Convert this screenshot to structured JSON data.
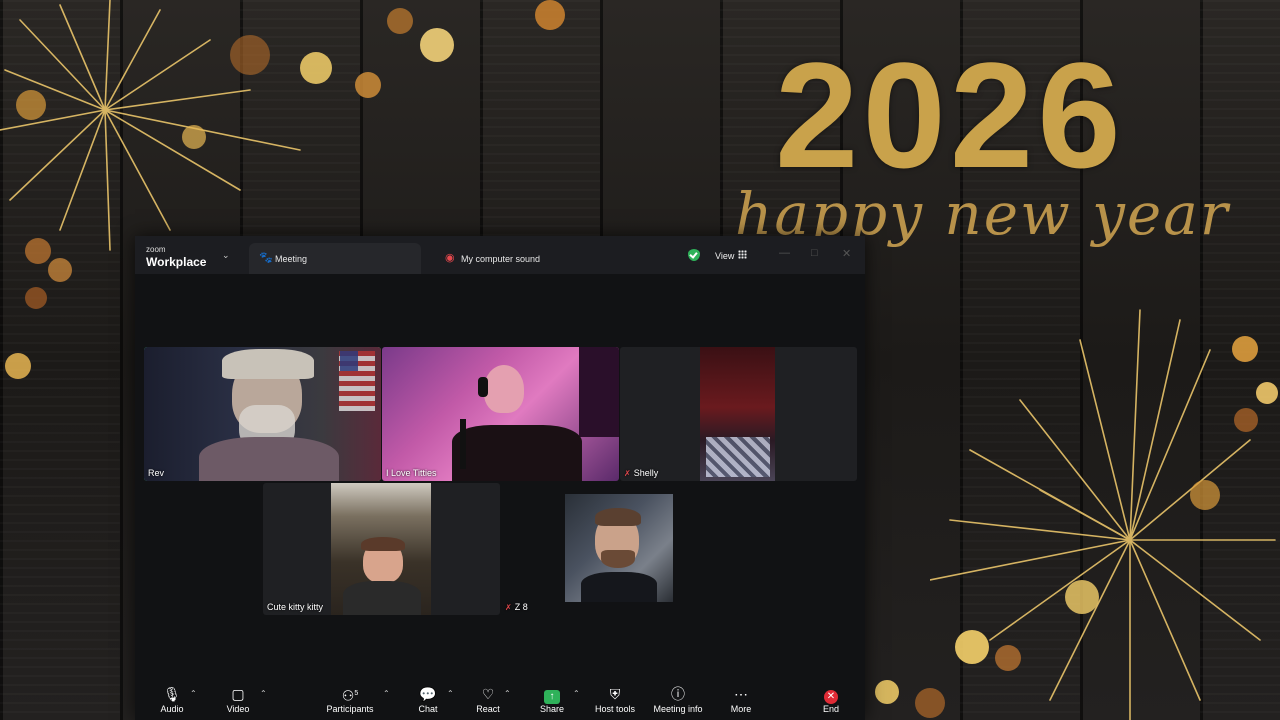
{
  "wallpaper": {
    "year": "2026",
    "greeting": "happy new year"
  },
  "window": {
    "brand_small": "zoom",
    "brand_big": "Workplace",
    "tabs": [
      {
        "label": "Meeting",
        "icon": "paw-icon"
      },
      {
        "label": "My computer sound",
        "icon": "audio-share-icon"
      }
    ],
    "view_label": "View"
  },
  "participants": [
    {
      "name": "Rev",
      "muted": false,
      "speaking": true
    },
    {
      "name": "I Love Titties",
      "muted": false,
      "speaking": false
    },
    {
      "name": "Shelly",
      "muted": true,
      "speaking": false
    },
    {
      "name": "Cute kitty kitty",
      "muted": false,
      "speaking": false
    },
    {
      "name": "Z 8",
      "muted": true,
      "speaking": false
    }
  ],
  "toolbar": {
    "audio": "Audio",
    "video": "Video",
    "participants": "Participants",
    "participant_count": "5",
    "chat": "Chat",
    "react": "React",
    "share": "Share",
    "host_tools": "Host tools",
    "meeting_info": "Meeting info",
    "more": "More",
    "end": "End"
  },
  "colors": {
    "speaker_outline": "#3ddc84",
    "share_green": "#2fb25a",
    "end_red": "#e02b36",
    "gold": "#c9a24b"
  }
}
